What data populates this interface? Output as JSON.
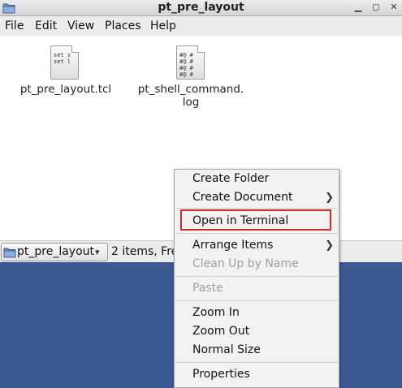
{
  "window": {
    "title": "pt_pre_layout"
  },
  "menubar": {
    "items": [
      "File",
      "Edit",
      "View",
      "Places",
      "Help"
    ]
  },
  "files": [
    {
      "name_line1": "pt_pre_layout.tcl",
      "name_line2": "",
      "preview": "set s\nset l"
    },
    {
      "name_line1": "pt_shell_command.",
      "name_line2": "log",
      "preview": "#@ #\n#@ #\n#@ #\n#@ #"
    }
  ],
  "statusbar": {
    "location": "pt_pre_layout",
    "info": "2 items, Fre"
  },
  "context_menu": {
    "items": [
      {
        "label": "Create Folder",
        "enabled": true,
        "submenu": false
      },
      {
        "label": "Create Document",
        "enabled": true,
        "submenu": true
      },
      {
        "label": "Open in Terminal",
        "enabled": true,
        "submenu": false,
        "highlighted": true
      },
      {
        "label": "Arrange Items",
        "enabled": true,
        "submenu": true
      },
      {
        "label": "Clean Up by Name",
        "enabled": false,
        "submenu": false
      },
      {
        "label": "Paste",
        "enabled": false,
        "submenu": false
      },
      {
        "label": "Zoom In",
        "enabled": true,
        "submenu": false
      },
      {
        "label": "Zoom Out",
        "enabled": true,
        "submenu": false
      },
      {
        "label": "Normal Size",
        "enabled": true,
        "submenu": false
      },
      {
        "label": "Properties",
        "enabled": true,
        "submenu": false
      }
    ]
  },
  "colors": {
    "desktop": "#3a5990",
    "highlight_box": "#d02b2b"
  }
}
